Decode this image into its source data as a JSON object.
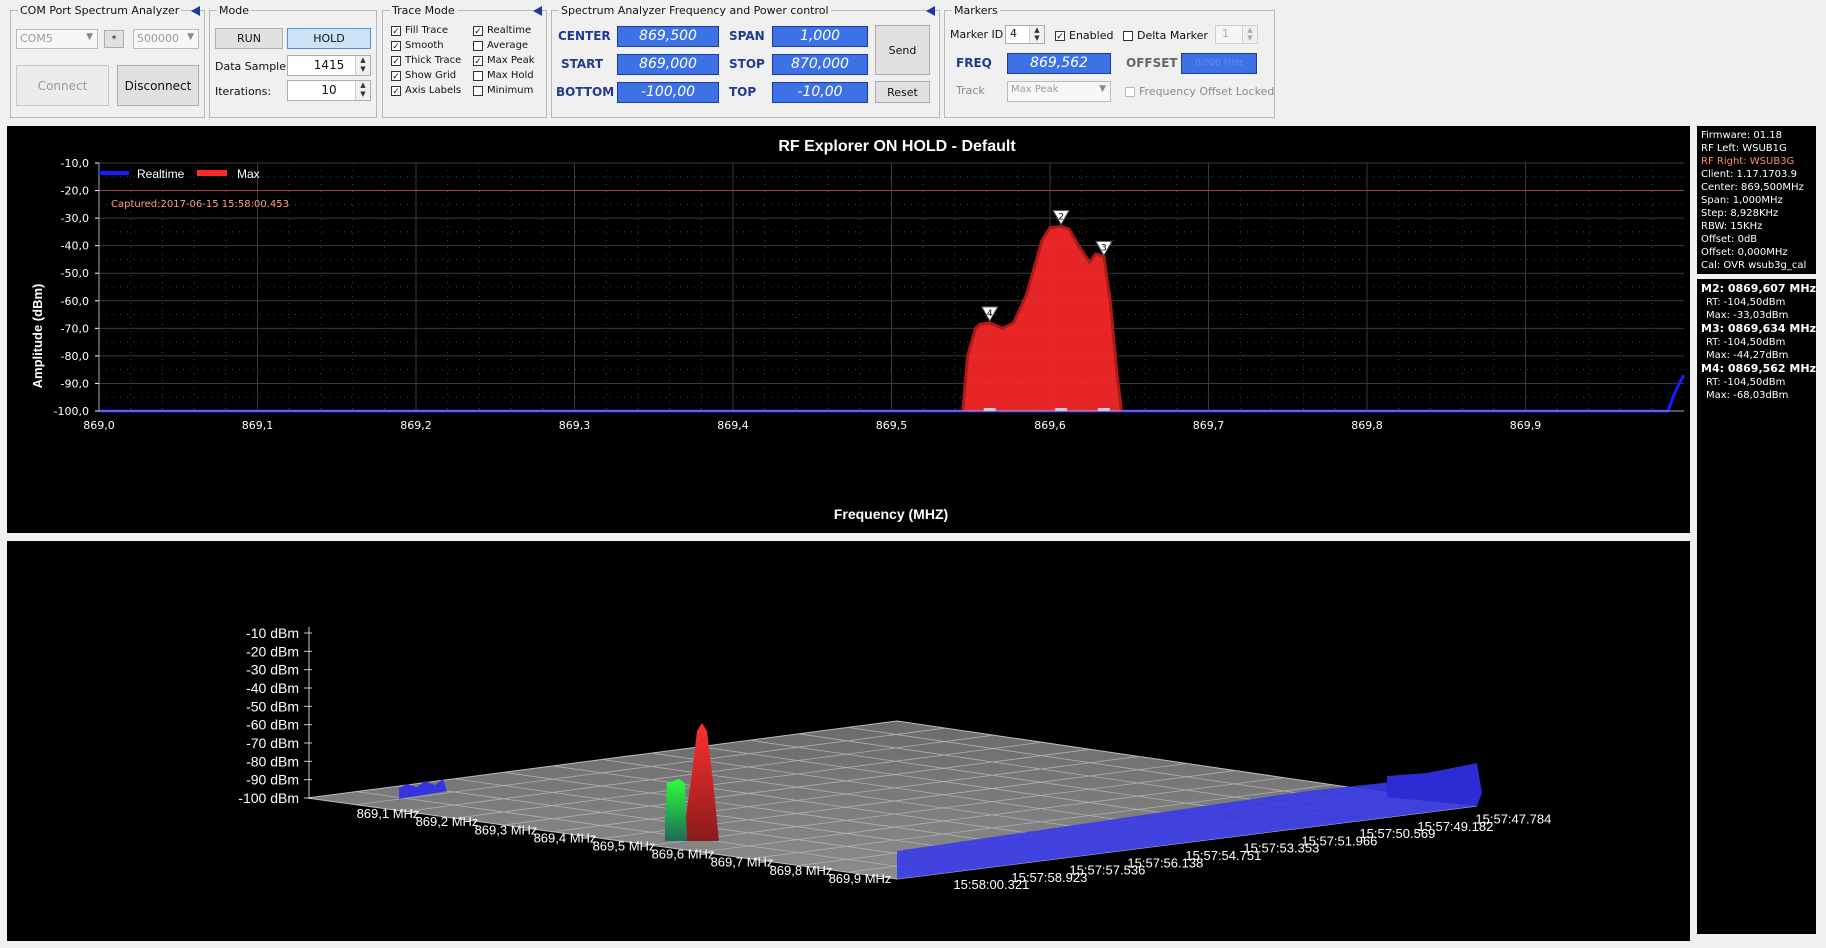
{
  "com_group": {
    "title": "COM Port Spectrum Analyzer",
    "port": "COM5",
    "star": "*",
    "baud": "500000",
    "connect_label": "Connect",
    "disconnect_label": "Disconnect"
  },
  "mode_group": {
    "title": "Mode",
    "run_label": "RUN",
    "hold_label": "HOLD",
    "data_sample_label": "Data Sample:",
    "data_sample_value": "1415",
    "iterations_label": "Iterations:",
    "iterations_value": "10"
  },
  "trace_group": {
    "title": "Trace Mode",
    "left": [
      {
        "label": "Fill Trace",
        "checked": true
      },
      {
        "label": "Smooth",
        "checked": true
      },
      {
        "label": "Thick Trace",
        "checked": true
      },
      {
        "label": "Show Grid",
        "checked": true
      },
      {
        "label": "Axis Labels",
        "checked": true
      }
    ],
    "right": [
      {
        "label": "Realtime",
        "checked": true
      },
      {
        "label": "Average",
        "checked": false
      },
      {
        "label": "Max Peak",
        "checked": true
      },
      {
        "label": "Max Hold",
        "checked": false
      },
      {
        "label": "Minimum",
        "checked": false
      }
    ]
  },
  "freq_group": {
    "title": "Spectrum Analyzer Frequency and Power control",
    "center_label": "CENTER",
    "center_value": "869,500",
    "span_label": "SPAN",
    "span_value": "1,000",
    "start_label": "START",
    "start_value": "869,000",
    "stop_label": "STOP",
    "stop_value": "870,000",
    "bottom_label": "BOTTOM",
    "bottom_value": "-100,00",
    "top_label": "TOP",
    "top_value": "-10,00",
    "send_label": "Send",
    "reset_label": "Reset"
  },
  "markers_group": {
    "title": "Markers",
    "marker_id_label": "Marker ID",
    "marker_id_value": "4",
    "enabled_label": "Enabled",
    "enabled_checked": true,
    "delta_label": "Delta Marker",
    "delta_checked": false,
    "delta_value": "1",
    "freq_label": "FREQ",
    "freq_value": "869,562",
    "offset_label": "OFFSET",
    "offset_value": "0,000 MHz",
    "track_label": "Track",
    "track_value": "Max Peak",
    "offset_locked_label": "Frequency Offset Locked"
  },
  "chart_data": {
    "type": "area",
    "title": "RF Explorer ON HOLD - Default",
    "xlabel": "Frequency (MHZ)",
    "ylabel": "Amplitude (dBm)",
    "captured": "Captured:2017-06-15 15:58:00.453",
    "xlim": [
      869.0,
      870.0
    ],
    "ylim": [
      -100,
      -10
    ],
    "x_ticks": [
      "869,0",
      "869,1",
      "869,2",
      "869,3",
      "869,4",
      "869,5",
      "869,6",
      "869,7",
      "869,8",
      "869,9"
    ],
    "y_ticks": [
      "-10,0",
      "-20,0",
      "-30,0",
      "-40,0",
      "-50,0",
      "-60,0",
      "-70,0",
      "-80,0",
      "-90,0",
      "-100,0"
    ],
    "legend": [
      "Realtime",
      "Max"
    ],
    "legend_position": "top-left",
    "grid": true,
    "reference_line_dbm": -20,
    "series": [
      {
        "name": "Realtime",
        "color": "#1a1aff",
        "x": [
          869.0,
          869.99,
          869.993,
          869.997,
          870.0
        ],
        "y": [
          -104.5,
          -104.5,
          -95,
          -90,
          -87
        ]
      },
      {
        "name": "Max",
        "color": "#ff2a2a",
        "x": [
          869.545,
          869.548,
          869.553,
          869.556,
          869.562,
          869.57,
          869.577,
          869.585,
          869.59,
          869.595,
          869.6,
          869.607,
          869.612,
          869.618,
          869.625,
          869.629,
          869.634,
          869.638,
          869.642,
          869.645
        ],
        "y": [
          -100,
          -80,
          -70,
          -68.5,
          -68,
          -70,
          -68,
          -58,
          -48,
          -38,
          -33.5,
          -33,
          -34,
          -40,
          -46,
          -43,
          -44,
          -60,
          -85,
          -100
        ]
      }
    ],
    "markers": [
      {
        "id": "4",
        "x": 869.562,
        "y": -68.03
      },
      {
        "id": "2",
        "x": 869.607,
        "y": -33.03
      },
      {
        "id": "3",
        "x": 869.634,
        "y": -44.27
      }
    ]
  },
  "waterfall": {
    "y_axis": [
      "-10 dBm",
      "-20 dBm",
      "-30 dBm",
      "-40 dBm",
      "-50 dBm",
      "-60 dBm",
      "-70 dBm",
      "-80 dBm",
      "-90 dBm",
      "-100 dBm"
    ],
    "freq_labels": [
      "869,1 MHz",
      "869,2 MHz",
      "869,3 MHz",
      "869,4 MHz",
      "869,5 MHz",
      "869,6 MHz",
      "869,7 MHz",
      "869,8 MHz",
      "869,9 MHz"
    ],
    "time_labels": [
      "15:58:00.321",
      "15:57:58.923",
      "15:57:57.536",
      "15:57:56.138",
      "15:57:54.751",
      "15:57:53.353",
      "15:57:51.966",
      "15:57:50.569",
      "15:57:49.182",
      "15:57:47.784"
    ]
  },
  "info_panel": {
    "lines": [
      "Firmware: 01.18",
      "RF Left: WSUB1G",
      "RF Right: WSUB3G",
      "Client: 1.17.1703.9",
      "Center: 869,500MHz",
      "Span: 1,000MHz",
      "Step: 8,928KHz",
      "RBW: 15KHz",
      "Offset: 0dB",
      "Offset: 0,000MHz",
      "Cal: OVR wsub3g_cal"
    ],
    "highlight_color": "#ff8c5a",
    "markers": [
      {
        "title": "M2: 0869,607 MHz",
        "rt": "RT: -104,50dBm",
        "max": "Max: -33,03dBm"
      },
      {
        "title": "M3: 0869,634 MHz",
        "rt": "RT: -104,50dBm",
        "max": "Max: -44,27dBm"
      },
      {
        "title": "M4: 0869,562 MHz",
        "rt": "RT: -104,50dBm",
        "max": "Max: -68,03dBm"
      }
    ]
  }
}
